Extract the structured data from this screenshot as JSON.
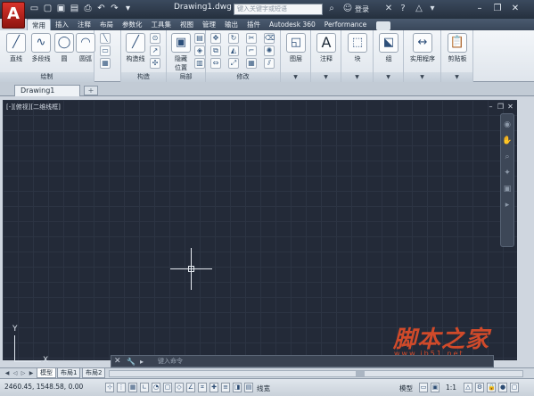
{
  "app": {
    "logo": "A",
    "document_title": "Drawing1.dwg",
    "search_placeholder": "键入关键字或短语",
    "login_label": "登录"
  },
  "quick_access": [
    "new-icon",
    "open-icon",
    "save-icon",
    "save-as-icon",
    "print-icon",
    "undo-icon",
    "redo-icon",
    "plot-icon"
  ],
  "ribbon_tabs": [
    "常用",
    "插入",
    "注释",
    "布局",
    "参数化",
    "工具集",
    "视图",
    "管理",
    "输出",
    "插件",
    "Autodesk 360",
    "Performance"
  ],
  "ribbon": {
    "draw": {
      "title": "绘制",
      "line": "直线",
      "polyline": "多段线",
      "circle": "圆",
      "arc": "圆弧"
    },
    "construct": {
      "title": "构造",
      "construction_line": "构造线"
    },
    "part": {
      "title": "局部",
      "hide_position": "隐藏",
      "hide_position_2": "位置"
    },
    "modify": {
      "title": "修改"
    },
    "layers": {
      "label": "图层"
    },
    "annotation": {
      "label": "注释"
    },
    "block": {
      "label": "块"
    },
    "groups": {
      "label": "组"
    },
    "utilities": {
      "label": "实用程序"
    },
    "clipboard": {
      "label": "剪贴板"
    }
  },
  "file_tab": {
    "label": "Drawing1",
    "new_tab": "+"
  },
  "viewport": {
    "label": "[-][俯视][二维线框]"
  },
  "ucs": {
    "x": "X",
    "y": "Y"
  },
  "command_line": {
    "close": "✕",
    "prompt": "▸",
    "placeholder": "键入命令"
  },
  "layout_tabs": [
    "模型",
    "布局1",
    "布局2"
  ],
  "status": {
    "coordinates": "2460.45, 1548.58, 0.00",
    "model_label": "模型",
    "lineweight_label": "线宽",
    "scale_label": "1:1"
  },
  "watermark": {
    "brand": "脚本之家",
    "url": "www.jb51.net"
  },
  "colors": {
    "canvas": "#232a38",
    "accent": "#d8342c",
    "ribbon": "#f3f6f9"
  }
}
